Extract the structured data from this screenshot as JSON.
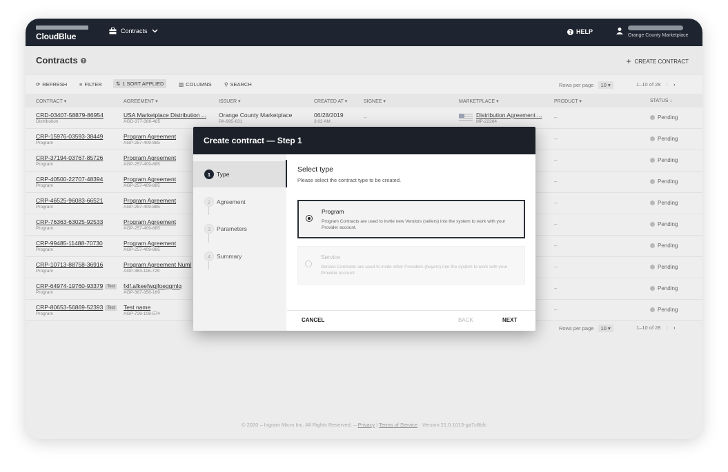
{
  "topbar": {
    "logo": "CloudBlue",
    "module": "Contracts",
    "help": "HELP",
    "account": "Orange County Marketplace"
  },
  "page": {
    "title": "Contracts",
    "create_button": "CREATE CONTRACT"
  },
  "toolbar": {
    "refresh": "REFRESH",
    "filter": "FILTER",
    "sort": "1 SORT APPLIED",
    "columns": "COLUMNS",
    "search": "SEARCH",
    "rows_per_page_label": "Rows per page",
    "rows_per_page_value": "10",
    "range": "1–10 of 28"
  },
  "columns": [
    "CONTRACT",
    "AGREEMENT",
    "ISSUER",
    "CREATED AT",
    "SIGNEE",
    "MARKETPLACE",
    "PRODUCT",
    "STATUS"
  ],
  "rows": [
    {
      "id": "CRD-03407-58879-86954",
      "type": "Distribution",
      "tag": "",
      "agreement": "USA Marketplace Distribution ...",
      "agreement_id": "AGD-377-386-485",
      "issuer": "Orange County Marketplace",
      "issuer_id": "PA-995-631",
      "created": "06/28/2019",
      "created_time": "3:02 AM",
      "signee": "–",
      "marketplace": "Distribution Agreement ...",
      "marketplace_id": "MP-22284",
      "product": "–",
      "status": "Pending"
    },
    {
      "id": "CRP-15976-03593-38449",
      "type": "Program",
      "tag": "",
      "agreement": "Program Agreement",
      "agreement_id": "AGP-257-409-885",
      "product": "–",
      "status": "Pending"
    },
    {
      "id": "CRP-37194-03767-85726",
      "type": "Program",
      "tag": "",
      "agreement": "Program Agreement",
      "agreement_id": "AGP-257-409-885",
      "product": "–",
      "status": "Pending"
    },
    {
      "id": "CRP-40500-22707-48394",
      "type": "Program",
      "tag": "",
      "agreement": "Program Agreement",
      "agreement_id": "AGP-257-409-885",
      "product": "–",
      "status": "Pending"
    },
    {
      "id": "CRP-46525-96083-66521",
      "type": "Program",
      "tag": "",
      "agreement": "Program Agreement",
      "agreement_id": "AGP-257-409-885",
      "product": "–",
      "status": "Pending"
    },
    {
      "id": "CRP-76363-63025-92533",
      "type": "Program",
      "tag": "",
      "agreement": "Program Agreement",
      "agreement_id": "AGP-257-409-885",
      "product": "–",
      "status": "Pending"
    },
    {
      "id": "CRP-99485-11488-70730",
      "type": "Program",
      "tag": "",
      "agreement": "Program Agreement",
      "agreement_id": "AGP-257-409-885",
      "product": "–",
      "status": "Pending"
    },
    {
      "id": "CRP-10713-88758-36916",
      "type": "Program",
      "tag": "",
      "agreement": "Program Agreement Numl",
      "agreement_id": "AGP-363-116-729",
      "product": "–",
      "status": "Pending"
    },
    {
      "id": "CRP-64974-19760-93379",
      "type": "Program",
      "tag": "Test",
      "agreement": "fxlf.afkeefwqjfoeggmlq",
      "agreement_id": "AGP-387-358-169",
      "product": "–",
      "status": "Pending"
    },
    {
      "id": "CRP-80653-56869-52393",
      "type": "Program",
      "tag": "Test",
      "agreement": "Test name",
      "agreement_id": "AGP-728-108-574",
      "product": "–",
      "status": "Pending"
    }
  ],
  "footer": {
    "copyright": "© 2020 – Ingram Micro Inc. All Rights Reserved. –",
    "privacy": "Privacy",
    "sep": "|",
    "terms": "Terms of Service",
    "version": "· Version 21.0.1013-ga7c8bfc"
  },
  "modal": {
    "title": "Create contract — Step 1",
    "steps": [
      {
        "num": "1",
        "label": "Type"
      },
      {
        "num": "2",
        "label": "Agreement"
      },
      {
        "num": "3",
        "label": "Parameters"
      },
      {
        "num": "4",
        "label": "Summary"
      }
    ],
    "select_title": "Select type",
    "select_sub": "Please select the contract type to be created.",
    "options": [
      {
        "title": "Program",
        "desc": "Program Contracts are used to invite new Vendors (sellers) into the system to work with your Provider account."
      },
      {
        "title": "Service",
        "desc": "Service Contracts are used to invite other Providers (buyers) into the system to work with your Provider account."
      }
    ],
    "cancel": "CANCEL",
    "back": "BACK",
    "next": "NEXT"
  }
}
